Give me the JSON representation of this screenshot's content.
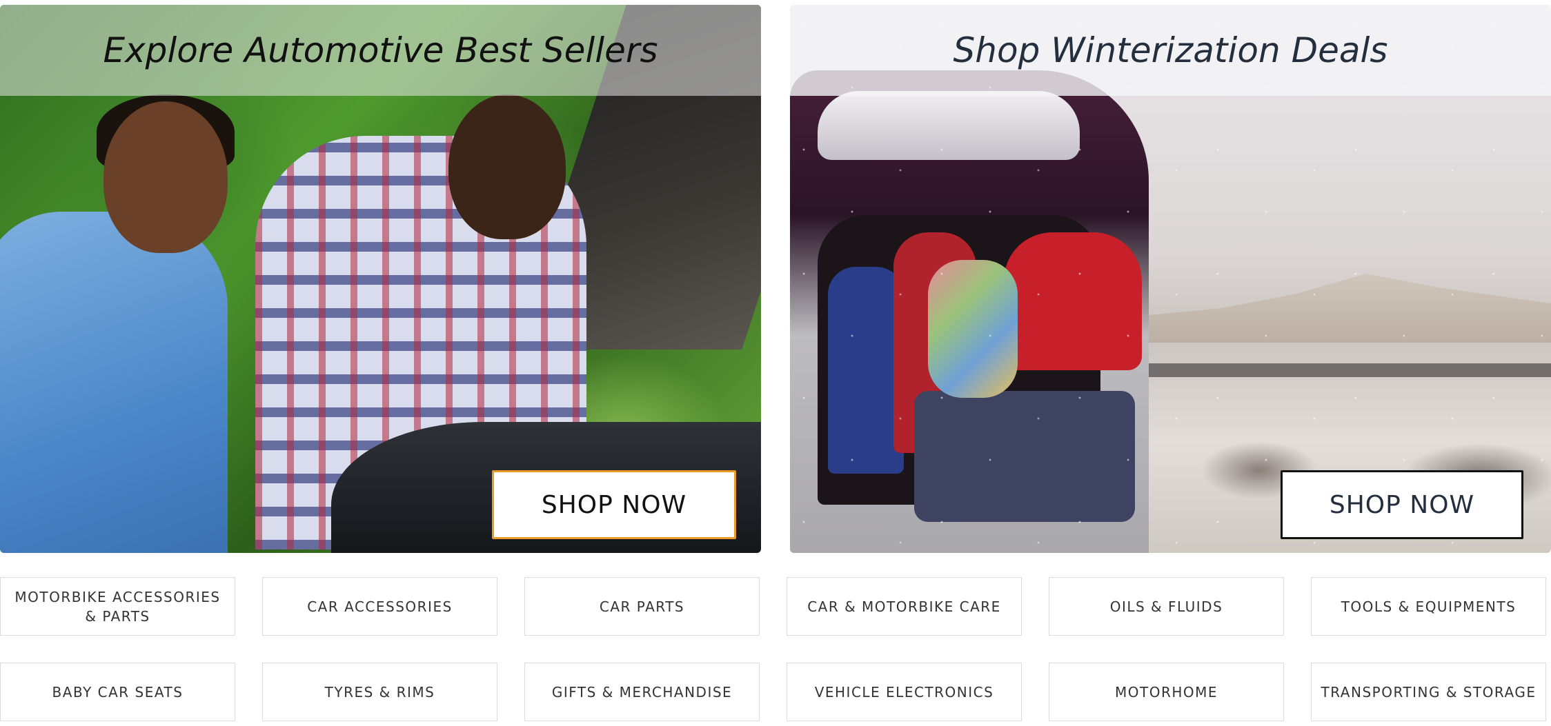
{
  "banners": {
    "left": {
      "title": "Explore Automotive Best Sellers",
      "button_label": "SHOP NOW"
    },
    "right": {
      "title": "Shop Winterization Deals",
      "button_label": "SHOP NOW"
    }
  },
  "categories": {
    "row1": [
      "MOTORBIKE ACCESSORIES & PARTS",
      "CAR ACCESSORIES",
      "CAR PARTS",
      "CAR & MOTORBIKE CARE",
      "OILS & FLUIDS",
      "TOOLS & EQUIPMENTS"
    ],
    "row2": [
      "BABY CAR SEATS",
      "TYRES & RIMS",
      "GIFTS & MERCHANDISE",
      "VEHICLE ELECTRONICS",
      "MOTORHOME",
      "TRANSPORTING & STORAGE"
    ]
  },
  "colors": {
    "left_button_border": "#e89b2a",
    "right_button_border": "#111111",
    "tile_border": "#dddddd",
    "tile_text": "#333333"
  }
}
